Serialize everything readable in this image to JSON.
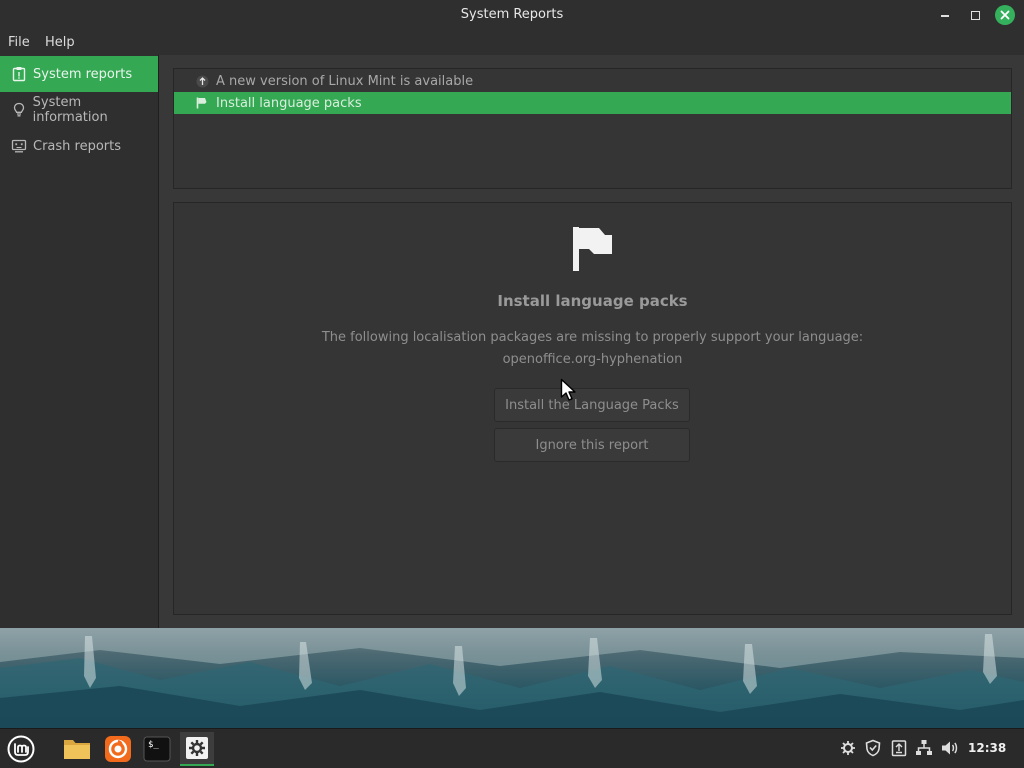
{
  "window": {
    "title": "System Reports"
  },
  "menu": {
    "items": [
      "File",
      "Help"
    ]
  },
  "sidebar": {
    "items": [
      {
        "label": "System reports",
        "icon": "clipboard-alert-icon",
        "active": true
      },
      {
        "label": "System information",
        "icon": "lightbulb-icon",
        "active": false
      },
      {
        "label": "Crash reports",
        "icon": "crash-monitor-icon",
        "active": false
      }
    ]
  },
  "reports": {
    "rows": [
      {
        "label": "A new version of Linux Mint is available",
        "icon": "upgrade-arrow-icon",
        "selected": false
      },
      {
        "label": "Install language packs",
        "icon": "flag-icon",
        "selected": true
      }
    ]
  },
  "detail": {
    "icon": "flag-icon",
    "title": "Install language packs",
    "description": "The following localisation packages are missing to properly support your language:",
    "package": "openoffice.org-hyphenation",
    "install_button": "Install the Language Packs",
    "ignore_button": "Ignore this report"
  },
  "panel": {
    "launchers": [
      "mint-menu-icon",
      "folder-icon",
      "firefox-icon",
      "terminal-icon",
      "system-reports-icon"
    ],
    "tray": [
      "update-manager-icon",
      "shield-icon",
      "clipboard-icon",
      "network-icon",
      "volume-icon"
    ],
    "clock": "12:38"
  },
  "colors": {
    "accent": "#35a854",
    "window_bg": "#383838",
    "panel_bg": "#2a2a2a"
  }
}
